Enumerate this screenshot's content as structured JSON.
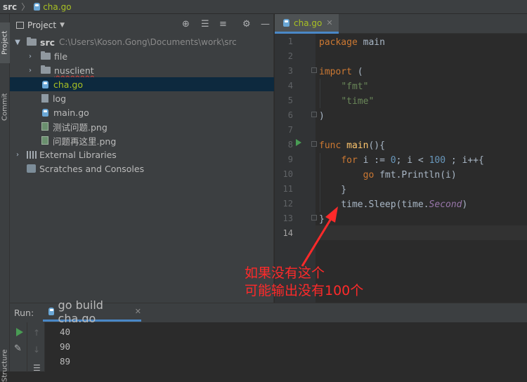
{
  "breadcrumb": {
    "root": "src",
    "separator": "〉",
    "file": "cha.go"
  },
  "side_tabs": {
    "project": "Project",
    "commit": "Commit",
    "structure": "Structure"
  },
  "project_panel": {
    "title": "Project",
    "tree": [
      {
        "label": "src",
        "path": "C:\\Users\\Koson.Gong\\Documents\\work\\src",
        "kind": "folder",
        "expanded": true,
        "depth": 0
      },
      {
        "label": "file",
        "kind": "folder",
        "expanded": false,
        "depth": 1
      },
      {
        "label": "nusclient",
        "kind": "folder",
        "expanded": false,
        "depth": 1
      },
      {
        "label": "cha.go",
        "kind": "go-file",
        "depth": 1,
        "selected": true
      },
      {
        "label": "log",
        "kind": "file",
        "depth": 1
      },
      {
        "label": "main.go",
        "kind": "go-file",
        "depth": 1
      },
      {
        "label": "测试问题.png",
        "kind": "image",
        "depth": 1
      },
      {
        "label": "问题再这里.png",
        "kind": "image",
        "depth": 1
      },
      {
        "label": "External Libraries",
        "kind": "library",
        "depth": 0
      },
      {
        "label": "Scratches and Consoles",
        "kind": "scratches",
        "depth": 0
      }
    ]
  },
  "editor": {
    "tab_label": "cha.go",
    "line_numbers": [
      "1",
      "2",
      "3",
      "4",
      "5",
      "6",
      "7",
      "8",
      "9",
      "10",
      "11",
      "12",
      "13",
      "14"
    ],
    "current_line": 14
  },
  "run_panel": {
    "label": "Run:",
    "tab_label": "go build cha.go",
    "output": [
      "40",
      "90",
      "89"
    ]
  },
  "annotation": {
    "line1": "如果没有这个",
    "line2": "可能输出没有100个",
    "color": "#ff2a2a"
  },
  "colors": {
    "accent": "#4a88c7",
    "keyword": "#cc7832",
    "string": "#6a8759",
    "number": "#6897bb",
    "function": "#ffc66d",
    "run_green": "#499c54"
  }
}
